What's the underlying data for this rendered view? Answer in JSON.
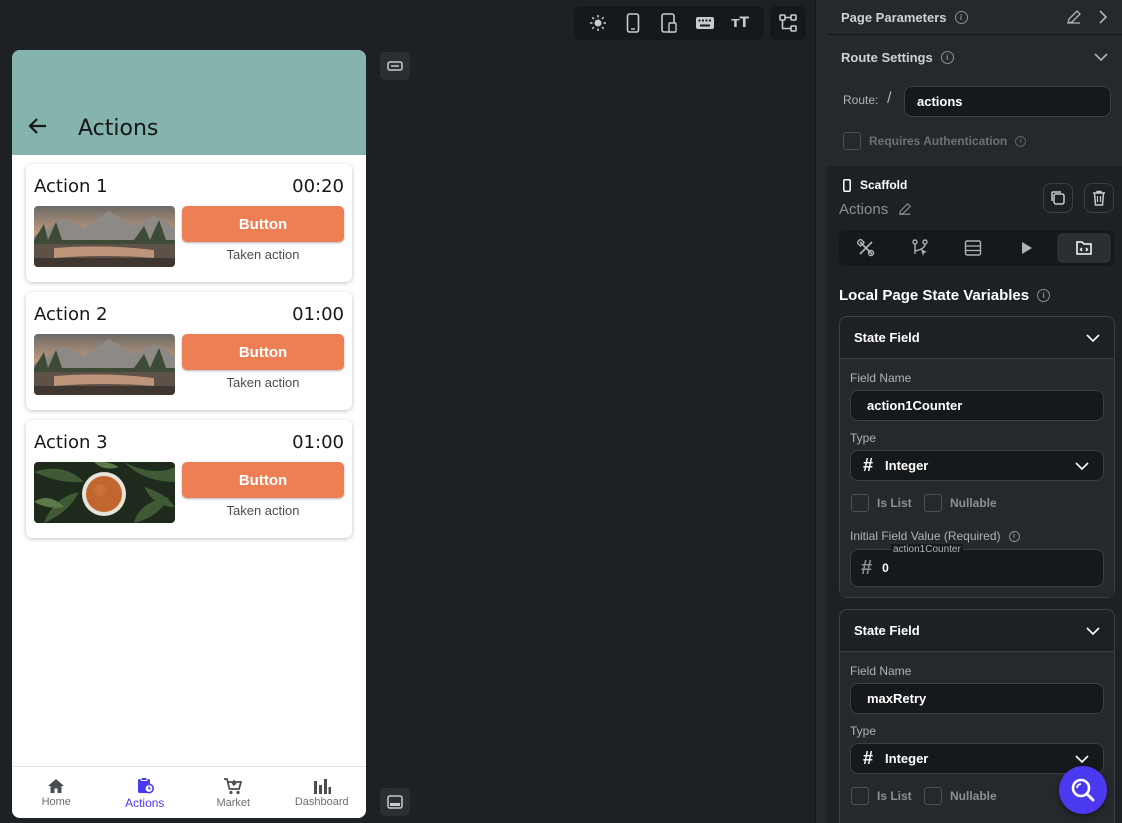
{
  "canvas": {
    "toolbar": {
      "icons": [
        "sun-icon",
        "phone-icon",
        "tablet-icon",
        "keyboard-icon",
        "text-size-icon"
      ],
      "text_size_glyph": "ᴛT"
    },
    "tree_icon": "widget-tree-icon"
  },
  "phone": {
    "appbar": {
      "title": "Actions",
      "back_icon": "arrow-left-icon",
      "color": "#84b4ac"
    },
    "cards": [
      {
        "title": "Action 1",
        "time": "00:20",
        "button": "Button",
        "subtitle": "Taken action",
        "image": "mountain-lake"
      },
      {
        "title": "Action 2",
        "time": "01:00",
        "button": "Button",
        "subtitle": "Taken action",
        "image": "mountain-lake"
      },
      {
        "title": "Action 3",
        "time": "01:00",
        "button": "Button",
        "subtitle": "Taken action",
        "image": "tea-leaves"
      }
    ],
    "button_color": "#ec7f53",
    "navbar": [
      {
        "label": "Home",
        "icon": "home-icon",
        "active": false
      },
      {
        "label": "Actions",
        "icon": "clipboard-clock-icon",
        "active": true
      },
      {
        "label": "Market",
        "icon": "cart-icon",
        "active": false
      },
      {
        "label": "Dashboard",
        "icon": "bar-chart-icon",
        "active": false
      }
    ],
    "accent": "#4b39ef"
  },
  "panel": {
    "page_parameters": {
      "label": "Page Parameters"
    },
    "route_settings": {
      "label": "Route Settings",
      "route_label": "Route:",
      "route_slash": "/",
      "route_value": "actions",
      "requires_auth_label": "Requires Authentication"
    },
    "scaffold": {
      "label": "Scaffold",
      "page_name": "Actions"
    },
    "tabs": [
      "properties-icon",
      "actions-flow-icon",
      "backend-query-icon",
      "play-icon",
      "state-icon"
    ],
    "local_state": {
      "heading": "Local Page State Variables",
      "fields": [
        {
          "title": "State Field",
          "field_name_label": "Field Name",
          "field_name": "action1Counter",
          "type_label": "Type",
          "type_symbol": "#",
          "type_value": "Integer",
          "is_list_label": "Is List",
          "nullable_label": "Nullable",
          "initial_label": "Initial Field Value (Required)",
          "initial_float_label": "action1Counter",
          "initial_value": "0"
        },
        {
          "title": "State Field",
          "field_name_label": "Field Name",
          "field_name": "maxRetry",
          "type_label": "Type",
          "type_symbol": "#",
          "type_value": "Integer",
          "is_list_label": "Is List",
          "nullable_label": "Nullable"
        }
      ]
    }
  },
  "fab": {
    "icon": "search-icon"
  }
}
